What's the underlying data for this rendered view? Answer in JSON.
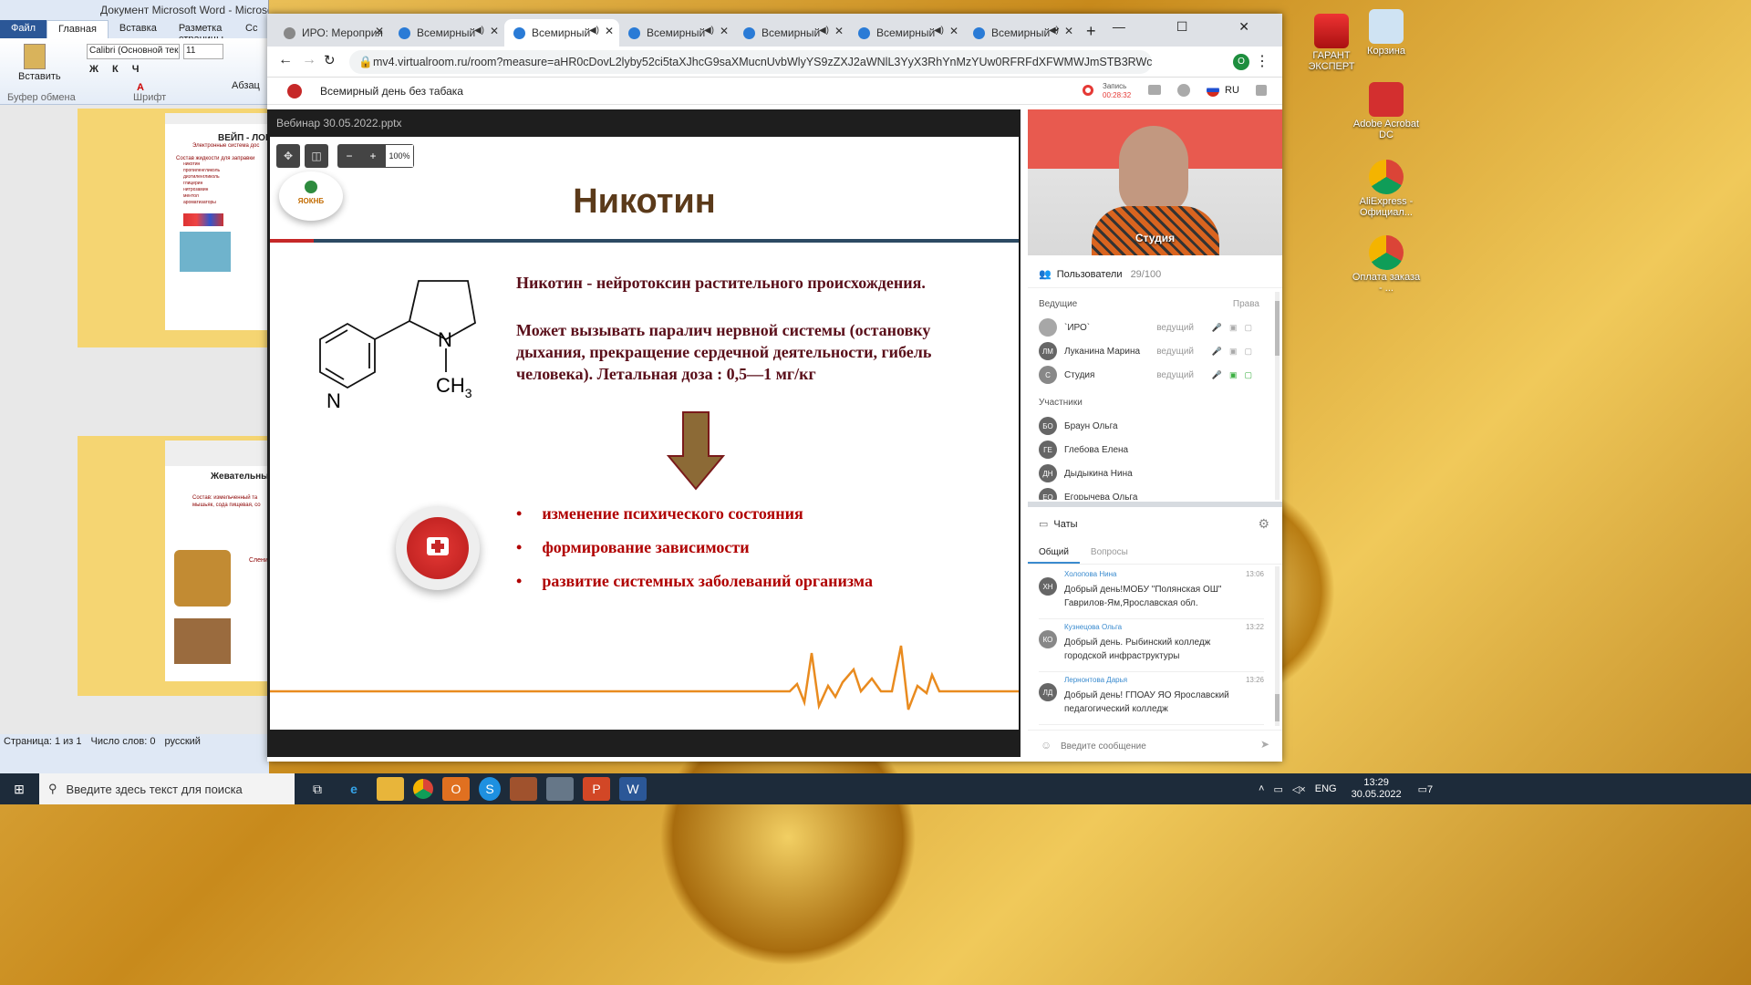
{
  "desktop": {
    "icons": [
      {
        "label": "ГАРАНТ ЭКСПЕРТ",
        "icon": "garant-icon"
      },
      {
        "label": "Корзина",
        "icon": "recycle-bin-icon"
      },
      {
        "label": "Adobe Acrobat DC",
        "icon": "acrobat-icon"
      },
      {
        "label": "AliExpress - Официал...",
        "icon": "chrome-icon"
      },
      {
        "label": "Оплата заказа - ...",
        "icon": "chrome-icon"
      }
    ]
  },
  "word": {
    "title": "Документ Microsoft Word - Microsoft Word",
    "tabs": [
      "Файл",
      "Главная",
      "Вставка",
      "Разметка страницы",
      "Сс"
    ],
    "font_name": "Calibri (Основной тек",
    "font_size": "11",
    "paste": "Вставить",
    "clipboard_group": "Буфер обмена",
    "font_group": "Шрифт",
    "paragraph": "Абзац",
    "page1_title": "ВЕЙП - ЛОВУ",
    "page1_subtitle": "Электронные система дос",
    "page1_list_title": "Состав жидкости для заправки",
    "page1_list": [
      "никотин",
      "пропиленгликоль",
      "диэтиленгликоль",
      "глицерин",
      "нитрозамин",
      "ментол",
      "ароматизаторы"
    ],
    "page2_title": "Жевательные",
    "page2_text": "Состав: измельченный та мышьяк, сода пищевая, со",
    "page2_caption": "Слени",
    "status_page": "Страница: 1 из 1",
    "status_words": "Число слов: 0",
    "status_lang": "русский"
  },
  "chrome": {
    "tabs": [
      {
        "label": "ИРО: Мероприя",
        "active": false
      },
      {
        "label": "Всемирный",
        "active": false
      },
      {
        "label": "Всемирный",
        "active": true
      },
      {
        "label": "Всемирный",
        "active": false
      },
      {
        "label": "Всемирный",
        "active": false
      },
      {
        "label": "Всемирный",
        "active": false
      },
      {
        "label": "Всемирный",
        "active": false
      }
    ],
    "url": "mv4.virtualroom.ru/room?measure=aHR0cDovL2lyby52ci5taXJhcG9saXMucnUvbWlyYS9zZXJ2aWNlL3YyX3RhYnMzYUw0RFRFdXFWMWJmSTB3RWc&user=guest-fa68e..."
  },
  "room": {
    "title": "Всемирный день без табака",
    "record_label": "Запись",
    "record_time": "00:28:32",
    "lang": "RU",
    "file_name": "Вебинар 30.05.2022.pptx",
    "zoom": "100%",
    "video_label": "Студия"
  },
  "slide": {
    "logo_text": "ЯОКНБ",
    "heading": "Никотин",
    "para1": "Никотин - нейротоксин растительного происхождения.",
    "para2": "Может вызывать паралич нервной системы (остановку дыхания, прекращение сердечной деятельности, гибель человека).  Летальная доза : 0,5—1 мг/кг",
    "bullets": [
      "изменение психического состояния",
      "формирование зависимости",
      "развитие системных заболеваний организма"
    ],
    "molecule_N1": "N",
    "molecule_N2": "N",
    "molecule_CH": "CH",
    "molecule_sub": "3"
  },
  "users": {
    "title": "Пользователи",
    "count": "29/100",
    "hosts_label": "Ведущие",
    "rights_label": "Права",
    "hosts": [
      {
        "initials": "",
        "name": "`ИРО`",
        "role": "ведущий"
      },
      {
        "initials": "ЛМ",
        "name": "Луканина Марина",
        "role": "ведущий"
      },
      {
        "initials": "С",
        "name": "Студия",
        "role": "ведущий"
      }
    ],
    "participants_label": "Участники",
    "participants": [
      {
        "initials": "БО",
        "name": "Браун Ольга"
      },
      {
        "initials": "ГЕ",
        "name": "Глебова Елена"
      },
      {
        "initials": "ДН",
        "name": "Дыдыкина Нина"
      },
      {
        "initials": "ЕО",
        "name": "Егорычева Ольга"
      }
    ]
  },
  "chat": {
    "title": "Чаты",
    "tab_general": "Общий",
    "tab_questions": "Вопросы",
    "messages": [
      {
        "initials": "ХН",
        "name": "Холопова Нина",
        "time": "13:06",
        "text": "Добрый день!МОБУ \"Полянская ОШ\" Гаврилов-Ям,Ярославская обл."
      },
      {
        "initials": "КО",
        "name": "Кузнецова Ольга",
        "time": "13:22",
        "text": "Добрый день. Рыбинский колледж городской инфраструктуры"
      },
      {
        "initials": "ЛД",
        "name": "Лернонтова Дарья",
        "time": "13:26",
        "text": "Добрый день! ГПОАУ ЯО Ярославский педагогический колледж"
      }
    ],
    "input_placeholder": "Введите сообщение"
  },
  "taskbar": {
    "search_placeholder": "Введите здесь текст для поиска",
    "lang": "ENG",
    "time": "13:29",
    "date": "30.05.2022",
    "notif_count": "7"
  },
  "colors": {
    "accent": "#2b5797",
    "slide_text": "#5a0f1a",
    "bullet": "#b00000",
    "heading": "#5b3a1a",
    "record": "#e53935"
  }
}
